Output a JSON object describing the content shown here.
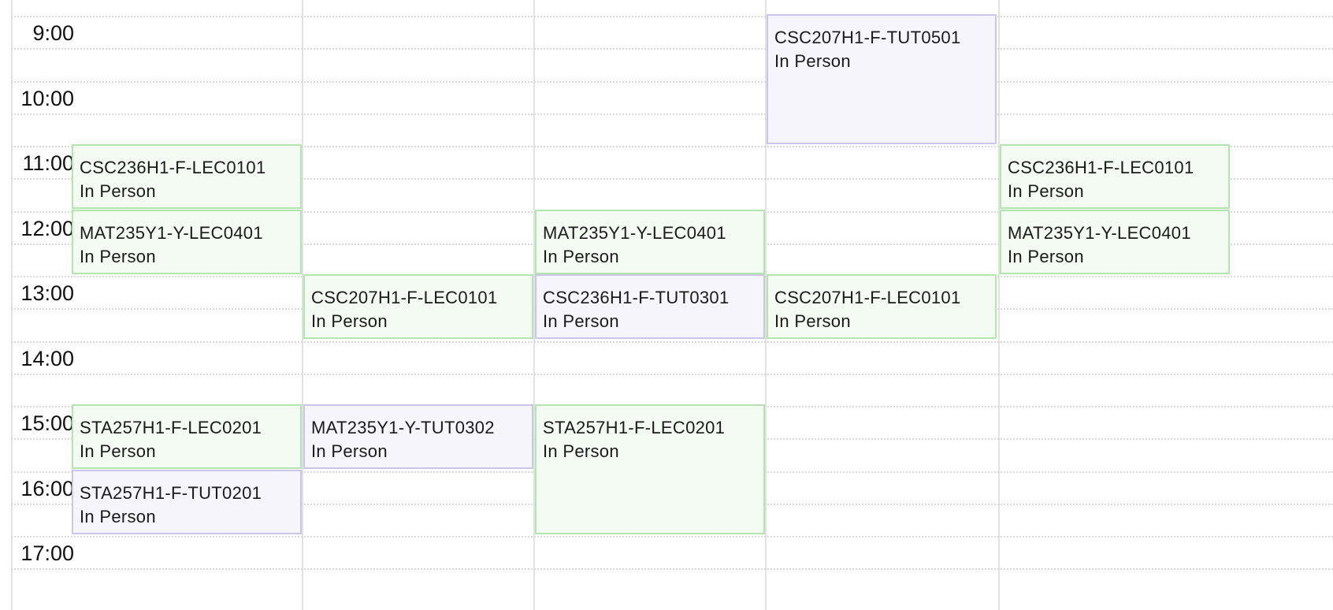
{
  "calendar": {
    "hours": [
      "9:00",
      "10:00",
      "11:00",
      "12:00",
      "13:00",
      "14:00",
      "15:00",
      "16:00",
      "17:00"
    ],
    "colors": {
      "lecture_bg": "#f4fbf3",
      "lecture_border": "#b3e6ac",
      "tutorial_bg": "#f6f5fb",
      "tutorial_border": "#c9c6ea"
    },
    "events": [
      {
        "code": "CSC207H1-F-TUT0501",
        "mode": "In Person",
        "day": 3,
        "start": 9,
        "end": 11,
        "kind": "tut"
      },
      {
        "code": "CSC236H1-F-LEC0101",
        "mode": "In Person",
        "day": 0,
        "start": 11,
        "end": 12,
        "kind": "lec"
      },
      {
        "code": "CSC236H1-F-LEC0101",
        "mode": "In Person",
        "day": 4,
        "start": 11,
        "end": 12,
        "kind": "lec"
      },
      {
        "code": "MAT235Y1-Y-LEC0401",
        "mode": "In Person",
        "day": 0,
        "start": 12,
        "end": 13,
        "kind": "lec"
      },
      {
        "code": "MAT235Y1-Y-LEC0401",
        "mode": "In Person",
        "day": 2,
        "start": 12,
        "end": 13,
        "kind": "lec"
      },
      {
        "code": "MAT235Y1-Y-LEC0401",
        "mode": "In Person",
        "day": 4,
        "start": 12,
        "end": 13,
        "kind": "lec"
      },
      {
        "code": "CSC207H1-F-LEC0101",
        "mode": "In Person",
        "day": 1,
        "start": 13,
        "end": 14,
        "kind": "lec"
      },
      {
        "code": "CSC236H1-F-TUT0301",
        "mode": "In Person",
        "day": 2,
        "start": 13,
        "end": 14,
        "kind": "tut"
      },
      {
        "code": "CSC207H1-F-LEC0101",
        "mode": "In Person",
        "day": 3,
        "start": 13,
        "end": 14,
        "kind": "lec"
      },
      {
        "code": "STA257H1-F-LEC0201",
        "mode": "In Person",
        "day": 0,
        "start": 15,
        "end": 16,
        "kind": "lec"
      },
      {
        "code": "MAT235Y1-Y-TUT0302",
        "mode": "In Person",
        "day": 1,
        "start": 15,
        "end": 16,
        "kind": "tut"
      },
      {
        "code": "STA257H1-F-LEC0201",
        "mode": "In Person",
        "day": 2,
        "start": 15,
        "end": 17,
        "kind": "lec"
      },
      {
        "code": "STA257H1-F-TUT0201",
        "mode": "In Person",
        "day": 0,
        "start": 16,
        "end": 17,
        "kind": "tut"
      }
    ]
  }
}
